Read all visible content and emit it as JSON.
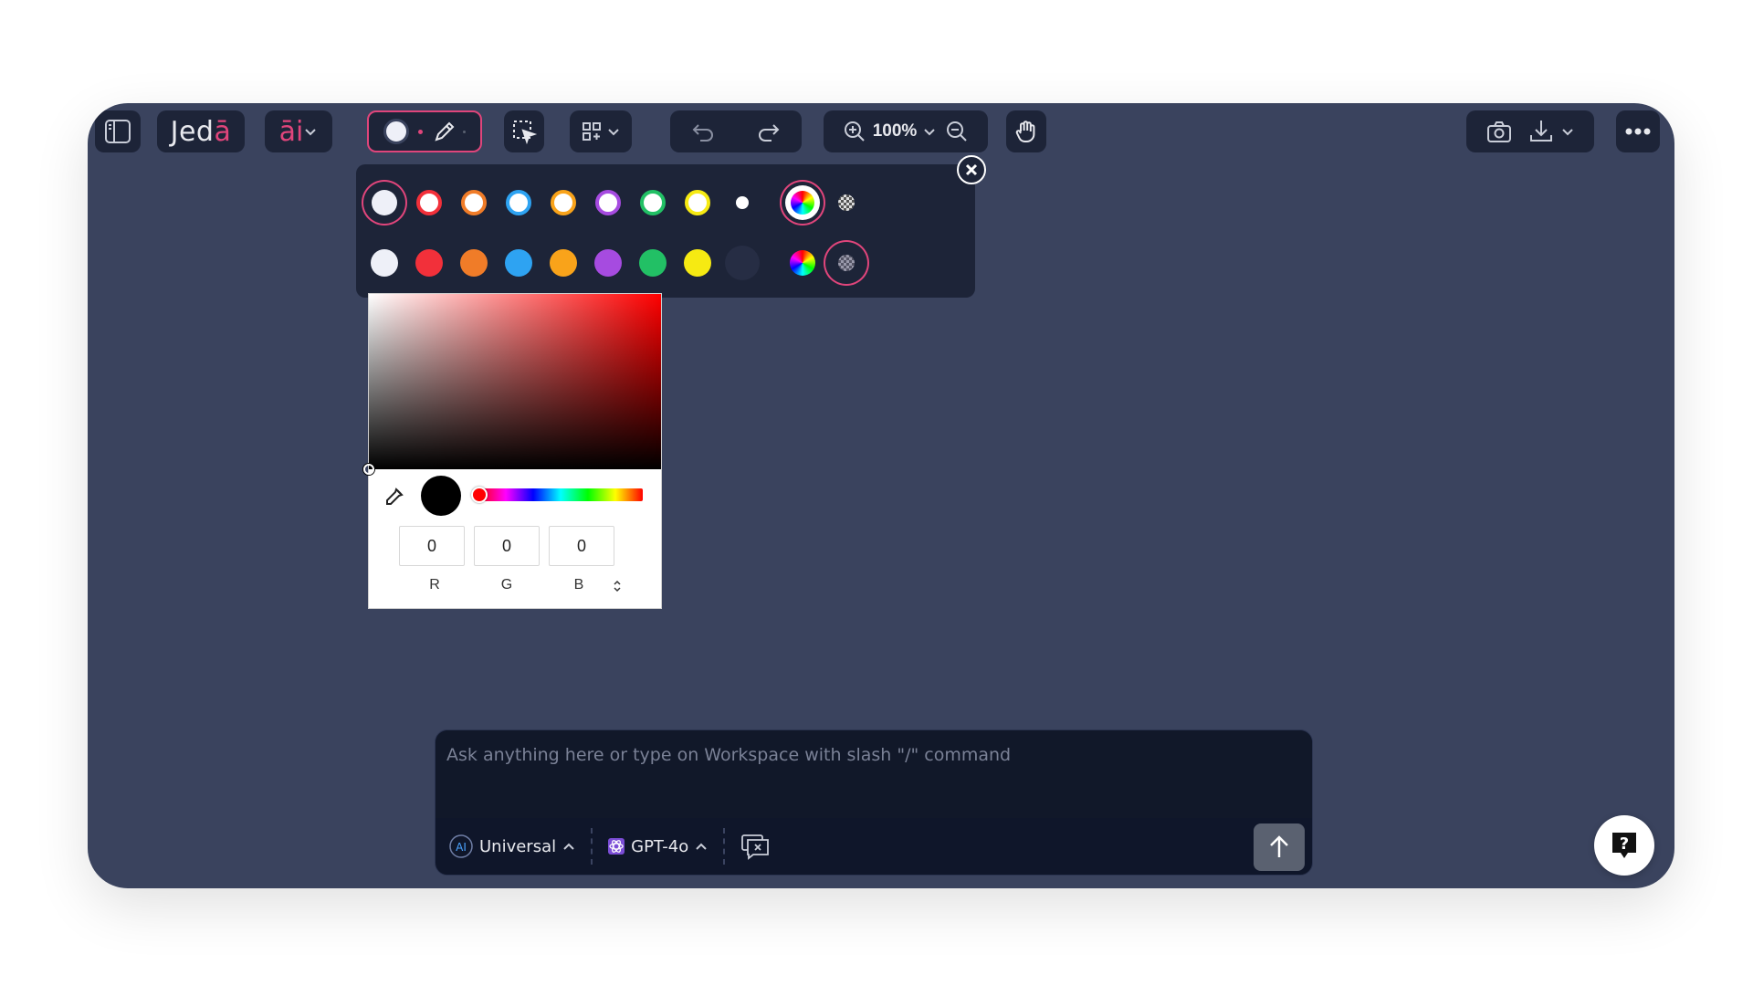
{
  "toolbar": {
    "logo_main": "Jed",
    "logo_accent": "ā",
    "ai_label": "āi",
    "zoom_level": "100%"
  },
  "palette": {
    "outline_colors": [
      "#ffffff",
      "#f2303a",
      "#f07c28",
      "#2ea3f2",
      "#f9a31a",
      "#a64be0",
      "#22c065",
      "#f6ea12",
      "#1d2438"
    ],
    "fill_colors": [
      "#eef0f8",
      "#f2303a",
      "#f07c28",
      "#2ea3f2",
      "#f9a31a",
      "#a64be0",
      "#22c065",
      "#f6ea12",
      "#262d44"
    ]
  },
  "color_picker": {
    "r": "0",
    "g": "0",
    "b": "0",
    "r_label": "R",
    "g_label": "G",
    "b_label": "B",
    "current_color": "#000000",
    "hue_color": "#ff0000"
  },
  "chat": {
    "placeholder": "Ask anything here or type on Workspace with slash \"/\" command",
    "mode_label": "Universal",
    "model_label": "GPT-4o"
  },
  "colors": {
    "canvas_bg": "#3a435e",
    "toolbar_bg": "#1d2438",
    "accent": "#e0457b"
  }
}
